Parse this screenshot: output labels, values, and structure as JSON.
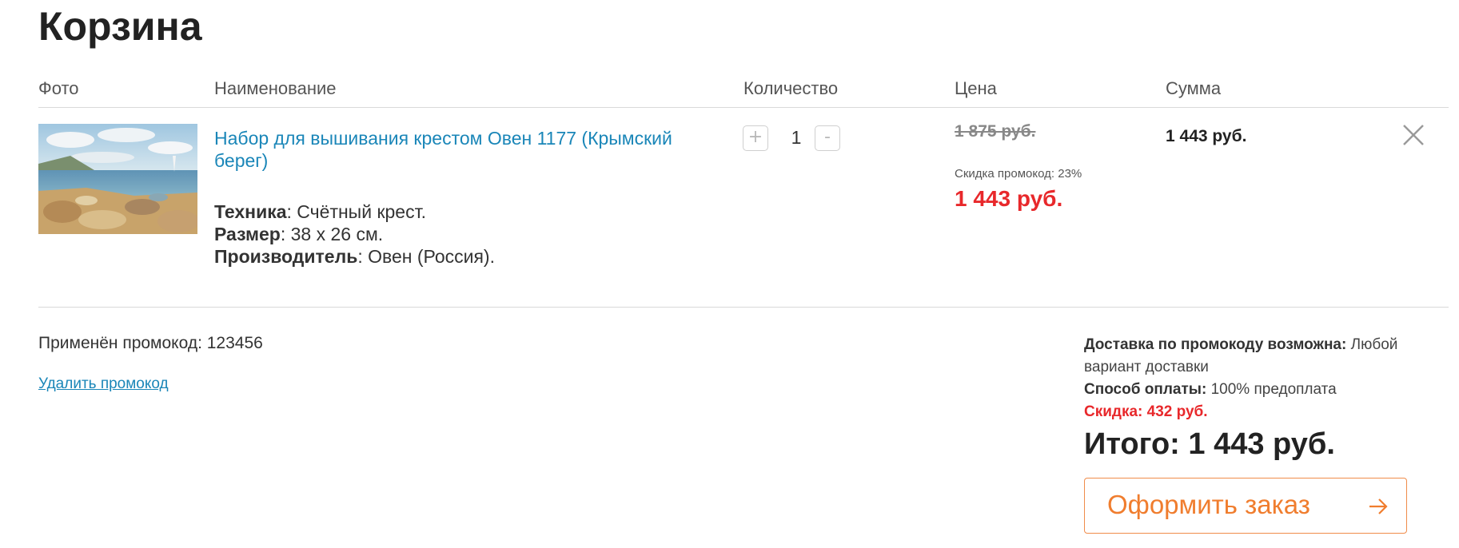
{
  "page": {
    "title": "Корзина"
  },
  "table": {
    "headers": {
      "photo": "Фото",
      "name": "Наименование",
      "qty": "Количество",
      "price": "Цена",
      "sum": "Сумма"
    }
  },
  "item": {
    "title": "Набор для вышивания крестом Овен 1177 (Крымский берег)",
    "specs": [
      {
        "label": "Техника",
        "value": ": Счётный крест."
      },
      {
        "label": "Размер",
        "value": ": 38 х 26 см."
      },
      {
        "label": "Производитель",
        "value": ": Овен (Россия)."
      }
    ],
    "qty": {
      "plus": "+",
      "value": "1",
      "minus": "-"
    },
    "old_price": "1 875 руб.",
    "discount_label": "Скидка промокод: 23%",
    "new_price": "1 443 руб.",
    "sum": "1 443 руб."
  },
  "promo": {
    "applied_label": "Применён промокод: 123456",
    "remove_link": "Удалить промокод"
  },
  "summary": {
    "delivery_label": "Доставка по промокоду возможна:",
    "delivery_value": "Любой вариант доставки",
    "payment_label": "Способ оплаты:",
    "payment_value": "100% предоплата",
    "discount": "Скидка: 432 руб.",
    "total": "Итого: 1 443 руб."
  },
  "checkout": {
    "label": "Оформить заказ"
  },
  "icons": {
    "remove": "close-icon",
    "checkout_arrow": "arrow-right-icon"
  },
  "colors": {
    "link": "#1a86b8",
    "sale_red": "#e8282b",
    "accent_orange": "#f07d2e"
  }
}
